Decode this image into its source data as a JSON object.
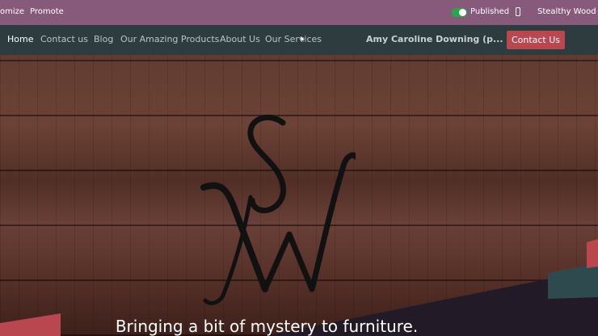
{
  "topbar": {
    "customize_label": "omize",
    "promote_label": "Promote",
    "published_label": "Published",
    "site_label": "Stealthy Wood"
  },
  "nav": {
    "links": [
      "Home",
      "Contact us",
      "Blog",
      "Our Amazing Products",
      "About Us",
      "Our Services"
    ],
    "user_label": "Amy Caroline Downing (p...",
    "cta_label": "Contact Us"
  },
  "hero": {
    "logo_letters": "SW",
    "tagline": "Bringing a bit of mystery to furniture."
  },
  "colors": {
    "topbar": "#875a7b",
    "navbar": "#2e3b3f",
    "accent": "#b8474f",
    "toggle_on": "#28a745"
  }
}
